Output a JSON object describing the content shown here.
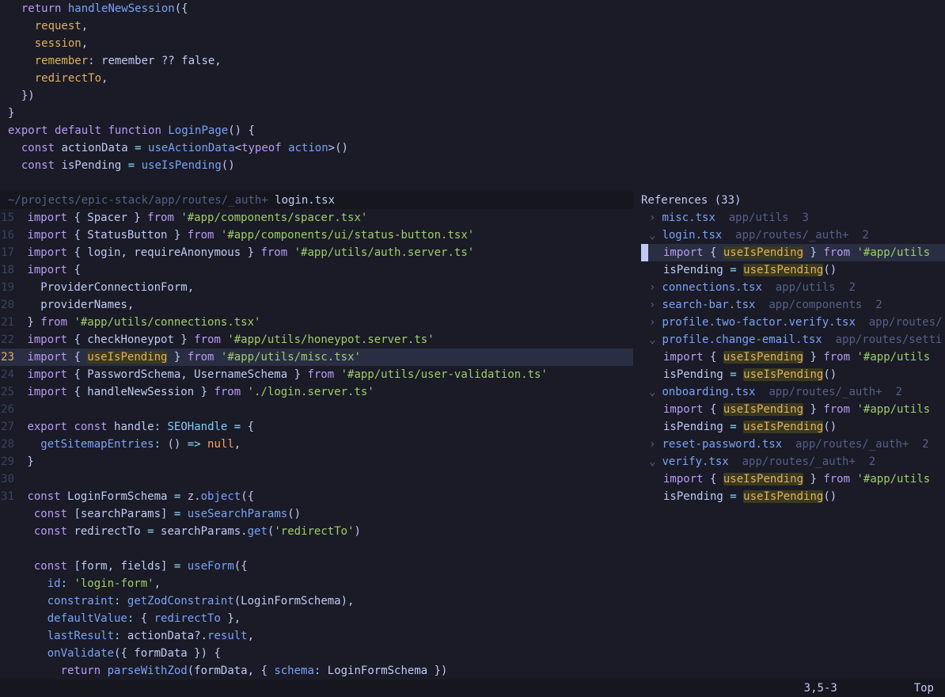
{
  "colors": {
    "bg": "#1a1b26",
    "fg": "#c0caf5",
    "keyword": "#bb9af7",
    "function": "#7aa2f7",
    "string": "#9ece6a",
    "type": "#7dcfff",
    "param": "#e0af68",
    "match": "#3b3a1d"
  },
  "top_pane": {
    "lines": [
      {
        "pre": "  ",
        "key": "return",
        "sp": " ",
        "fn": "handleNewSession",
        "rest": "({"
      },
      {
        "pre": "    ",
        "param": "request",
        "rest": ","
      },
      {
        "pre": "    ",
        "param": "session",
        "rest": ","
      },
      {
        "pre": "    ",
        "param": "remember",
        "rest": ": remember ?? false,"
      },
      {
        "pre": "    ",
        "param": "redirectTo",
        "rest": ","
      },
      {
        "pre": "  ",
        "rest": "})"
      },
      {
        "pre": "",
        "rest": "}"
      },
      {
        "pre": "",
        "rest": ""
      },
      {
        "pre": "",
        "raw_html": "<span class='tok-key'>export</span> <span class='tok-key'>default</span> <span class='tok-key'>function</span> <span class='tok-fn'>LoginPage</span>() {"
      },
      {
        "pre": "  ",
        "raw_html": "<span class='tok-key'>const</span> actionData <span class='tok-op'>=</span> <span class='tok-fn'>useActionData</span>&lt;<span class='tok-key'>typeof</span> <span class='tok-fn'>action</span>&gt;()"
      },
      {
        "pre": "  ",
        "raw_html": "<span class='tok-key'>const</span> isPending <span class='tok-op'>=</span> <span class='tok-fn'>useIsPending</span>()"
      }
    ]
  },
  "winbar": {
    "dir": "~/projects/epic-stack/app/routes/_auth+",
    "file": " login.tsx"
  },
  "bottom_pane": {
    "start": 15,
    "current": 23,
    "lines": [
      {
        "n": 15,
        "html": "<span class='tok-key'>import</span> { Spacer } <span class='tok-key'>from</span> <span class='tok-str'>'#app/components/spacer.tsx'</span>"
      },
      {
        "n": 16,
        "html": "<span class='tok-key'>import</span> { StatusButton } <span class='tok-key'>from</span> <span class='tok-str'>'#app/components/ui/status-button.tsx'</span>"
      },
      {
        "n": 17,
        "html": "<span class='tok-key'>import</span> { login, requireAnonymous } <span class='tok-key'>from</span> <span class='tok-str'>'#app/utils/auth.server.ts'</span>"
      },
      {
        "n": 18,
        "html": "<span class='tok-key'>import</span> {"
      },
      {
        "n": 19,
        "html": "  ProviderConnectionForm,"
      },
      {
        "n": 20,
        "html": "  providerNames,"
      },
      {
        "n": 21,
        "html": "} <span class='tok-key'>from</span> <span class='tok-str'>'#app/utils/connections.tsx'</span>"
      },
      {
        "n": 22,
        "html": "<span class='tok-key'>import</span> { checkHoneypot } <span class='tok-key'>from</span> <span class='tok-str'>'#app/utils/honeypot.server.ts'</span>"
      },
      {
        "n": 23,
        "html": "<span class='tok-key'>import</span> { <span class='hl-match'>useIsPending</span> } <span class='tok-key'>from</span> <span class='tok-str'>'#app/utils/misc.tsx'</span>"
      },
      {
        "n": 24,
        "html": "<span class='tok-key'>import</span> { PasswordSchema, UsernameSchema } <span class='tok-key'>from</span> <span class='tok-str'>'#app/utils/user-validation.ts'</span>"
      },
      {
        "n": 25,
        "html": "<span class='tok-key'>import</span> { handleNewSession } <span class='tok-key'>from</span> <span class='tok-str'>'./login.server.ts'</span>"
      },
      {
        "n": 26,
        "html": ""
      },
      {
        "n": 27,
        "html": "<span class='tok-key'>export</span> <span class='tok-key'>const</span> handle<span class='tok-op'>:</span> <span class='tok-type'>SEOHandle</span> <span class='tok-op'>=</span> {"
      },
      {
        "n": 28,
        "html": "  <span class='tok-field'>getSitemapEntries</span><span class='tok-op'>:</span> () <span class='tok-op'>=&gt;</span> <span class='tok-null'>null</span>,"
      },
      {
        "n": 29,
        "html": "}"
      },
      {
        "n": 30,
        "html": ""
      },
      {
        "n": 31,
        "html": "<span class='tok-key'>const</span> LoginFormSchema <span class='tok-op'>=</span> z.<span class='tok-fn'>object</span>({"
      }
    ],
    "tail": [
      "  <span class='tok-key'>const</span> [searchParams] <span class='tok-op'>=</span> <span class='tok-fn'>useSearchParams</span>()",
      "  <span class='tok-key'>const</span> redirectTo <span class='tok-op'>=</span> searchParams.<span class='tok-fn'>get</span>(<span class='tok-str'>'redirectTo'</span>)",
      "",
      "  <span class='tok-key'>const</span> [form, fields] <span class='tok-op'>=</span> <span class='tok-fn'>useForm</span>({",
      "    <span class='tok-field'>id</span><span class='tok-op'>:</span> <span class='tok-str'>'login-form'</span>,",
      "    <span class='tok-field'>constraint</span><span class='tok-op'>:</span> <span class='tok-fn'>getZodConstraint</span>(LoginFormSchema),",
      "    <span class='tok-field'>defaultValue</span><span class='tok-op'>:</span> { <span class='tok-field'>redirectTo</span> },",
      "    <span class='tok-field'>lastResult</span><span class='tok-op'>:</span> actionData?.<span class='tok-field'>result</span>,",
      "    <span class='tok-fn'>onValidate</span>({ formData }) {",
      "      <span class='tok-key'>return</span> <span class='tok-fn'>parseWithZod</span>(formData, { <span class='tok-field'>schema</span><span class='tok-op'>:</span> LoginFormSchema })"
    ]
  },
  "references": {
    "title": "References (33)",
    "items": [
      {
        "caret": "›",
        "file": "misc.tsx",
        "path": "app/utils",
        "count": "3"
      },
      {
        "caret": "⌄",
        "file": "login.tsx",
        "path": "app/routes/_auth+",
        "count": "2",
        "children": [
          {
            "sel": true,
            "html": "<span class='tok-key'>import</span> { <span class='hl-match'>useIsPending</span> } <span class='tok-key'>from</span> <span class='tok-str'>'#app/utils</span>"
          },
          {
            "html": "isPending <span class='tok-op'>=</span> <span class='hl-match'>useIsPending</span>()"
          }
        ]
      },
      {
        "caret": "›",
        "file": "connections.tsx",
        "path": "app/utils",
        "count": "2"
      },
      {
        "caret": "›",
        "file": "search-bar.tsx",
        "path": "app/components",
        "count": "2"
      },
      {
        "caret": "›",
        "file": "profile.two-factor.verify.tsx",
        "path": "app/routes/",
        "count": ""
      },
      {
        "caret": "⌄",
        "file": "profile.change-email.tsx",
        "path": "app/routes/setti",
        "count": "",
        "children": [
          {
            "html": "<span class='tok-key'>import</span> { <span class='hl-match'>useIsPending</span> } <span class='tok-key'>from</span> <span class='tok-str'>'#app/utils</span>"
          },
          {
            "html": "isPending <span class='tok-op'>=</span> <span class='hl-match'>useIsPending</span>()"
          }
        ]
      },
      {
        "caret": "⌄",
        "file": "onboarding.tsx",
        "path": "app/routes/_auth+",
        "count": "2",
        "children": [
          {
            "html": "<span class='tok-key'>import</span> { <span class='hl-match'>useIsPending</span> } <span class='tok-key'>from</span> <span class='tok-str'>'#app/utils</span>"
          },
          {
            "html": "isPending <span class='tok-op'>=</span> <span class='hl-match'>useIsPending</span>()"
          }
        ]
      },
      {
        "caret": "›",
        "file": "reset-password.tsx",
        "path": "app/routes/_auth+",
        "count": "2"
      },
      {
        "caret": "⌄",
        "file": "verify.tsx",
        "path": "app/routes/_auth+",
        "count": "2",
        "children": [
          {
            "html": "<span class='tok-key'>import</span> { <span class='hl-match'>useIsPending</span> } <span class='tok-key'>from</span> <span class='tok-str'>'#app/utils</span>"
          },
          {
            "html": "isPending <span class='tok-op'>=</span> <span class='hl-match'>useIsPending</span>()"
          }
        ]
      }
    ]
  },
  "status": {
    "pos": "3,5-3",
    "pct": "Top"
  }
}
